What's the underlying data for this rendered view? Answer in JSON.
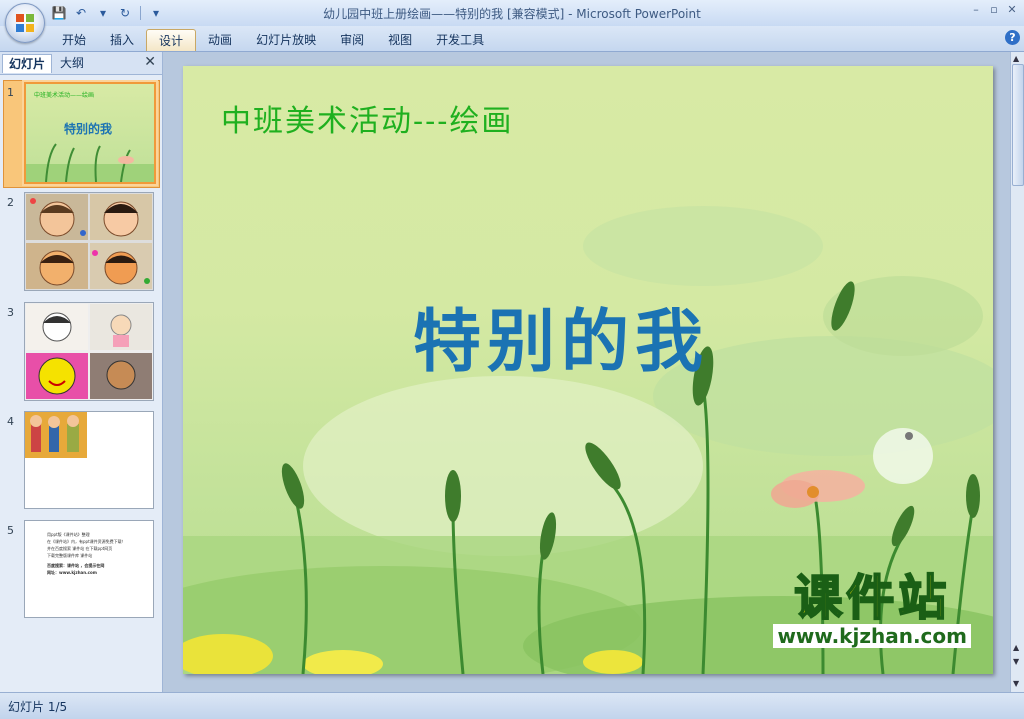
{
  "window": {
    "title": "幼儿园中班上册绘画——特别的我 [兼容模式] - Microsoft PowerPoint",
    "controls": [
      "–",
      "▫",
      "✕"
    ]
  },
  "qat": {
    "save_icon": "💾",
    "undo_icon": "↶",
    "redo_icon": "↻",
    "more": "▾"
  },
  "ribbon": {
    "tabs": [
      "开始",
      "插入",
      "设计",
      "动画",
      "幻灯片放映",
      "审阅",
      "视图",
      "开发工具"
    ],
    "active_tab": "设计",
    "help": "?"
  },
  "left_pane": {
    "tabs": [
      "幻灯片",
      "大纲"
    ],
    "close": "✕",
    "slides": [
      {
        "num": "1",
        "mini_subtitle": "中班美术活动——绘画",
        "mini_title": "特别的我"
      },
      {
        "num": "2"
      },
      {
        "num": "3"
      },
      {
        "num": "4"
      },
      {
        "num": "5",
        "lines": [
          "用ppt版《课件站》整理",
          "在《课件站》内，有ppt课件资源免费下载！",
          "并在百度搜索 课件站 在下载ppt网页",
          "下载完整版课件库 课件站",
          "百度搜索：课件站 ，会提示在网",
          "网址：www.kjzhan.com"
        ]
      }
    ]
  },
  "slide": {
    "subtitle": "中班美术活动---绘画",
    "title": "特别的我",
    "watermark_big": "课件站",
    "watermark_url": "www.kjzhan.com"
  },
  "status": {
    "text": "幻灯片 1/5"
  },
  "colors": {
    "accent_selection": "#f09a3a",
    "title_blue": "#1b73b3",
    "subtitle_green": "#1fb01f",
    "slide_bg": "#d4e9a3"
  }
}
